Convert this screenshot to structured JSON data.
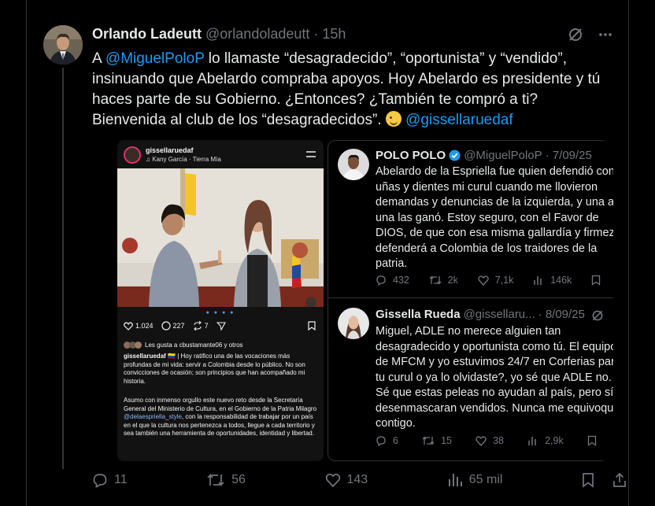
{
  "tweet": {
    "author_name": "Orlando Ladeutt",
    "handle": "@orlandoladeutt",
    "time": "· 15h",
    "text_a": "A ",
    "mention_1": "@MiguelPoloP",
    "text_b": " lo llamaste “desagradecido”, “oportunista” y “vendido”, insinuando que Abelardo compraba apoyos. Hoy Abelardo es presidente y tú haces parte de su Gobierno. ¿Entonces? ¿También te compró a ti? Bienvenida al club de los “desagradecidos”. ",
    "mention_2": "@gissellaruedaf",
    "actions": {
      "replies": "11",
      "retweets": "56",
      "likes": "143",
      "views": "65 mil"
    }
  },
  "instagram": {
    "username": "gissellaruedaf",
    "music": "Kany García · Tierra Mía",
    "likes": "1.024",
    "comments": "227",
    "reposts": "7",
    "liked_by": "Les gusta a cbustamante06 y otros",
    "caption_user": "gissellaruedaf",
    "caption_1": " 🇨🇴 | Hoy ratifico una de las vocaciones más profundas de mi vida: servir a Colombia desde lo público. No son convicciones de ocasión; son principios que han acompañado mi historia.",
    "caption_2a": "Asumo con inmenso orgullo este nuevo reto desde la Secretaría General del Ministerio de Cultura, en el Gobierno de la Patria Milagro ",
    "caption_mention": "@delaespriella_style",
    "caption_2b": ", con la responsabilidad de trabajar por un país en el que la cultura nos pertenezca a todos, llegue a cada territorio y sea también una herramienta de oportunidades, identidad y libertad."
  },
  "quote1": {
    "name": "POLO POLO",
    "handle": "@MiguelPoloP",
    "date": "· 7/09/25",
    "text": "Abelardo de la Espriella fue quien defendió con uñas y dientes mi curul cuando me llovieron demandas y denuncias de la izquierda, y una a una las ganó. Estoy seguro, con el Favor de DIOS, de que con esa misma gallardía y firmeza defenderá a Colombia de los traidores de la patria.",
    "replies": "432",
    "retweets": "2k",
    "likes": "7,1k",
    "views": "146k"
  },
  "quote2": {
    "name": "Gissella Rueda",
    "handle": "@gissellaru...",
    "date": "· 8/09/25",
    "text": "Miguel, ADLE no merece alguien tan desagradecido y oportunista como tú. El equipo de MFCM y yo estuvimos 24/7 en Corferias para tu curul o ya lo olvidaste?, yo sé que ADLE no. Sé que estas peleas no ayudan al país, pero sí desenmascaran vendidos. Nunca me equivoqué contigo.",
    "replies": "6",
    "retweets": "15",
    "likes": "38",
    "views": "2,9k"
  },
  "colors": {
    "accent": "#1d9bf0",
    "muted": "#71767b",
    "text": "#e7e9ea",
    "border": "#2f3336"
  }
}
